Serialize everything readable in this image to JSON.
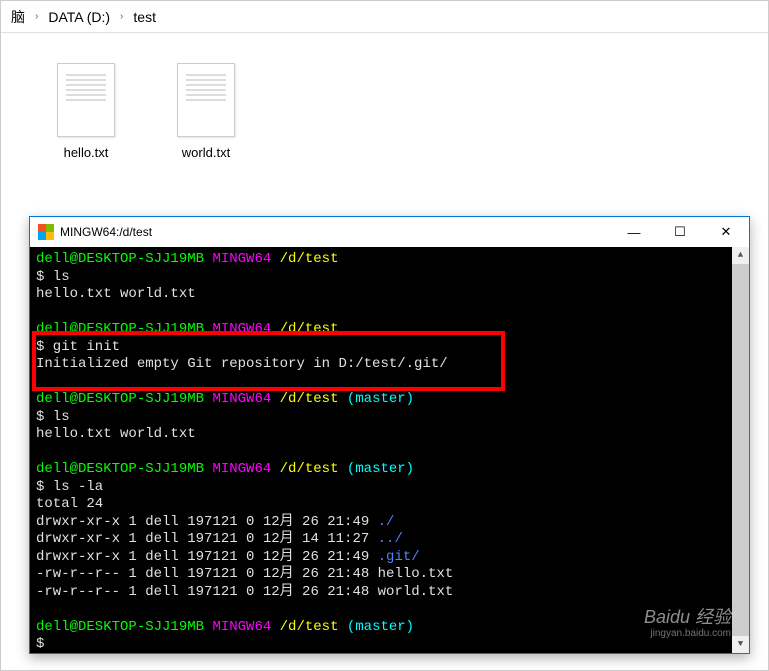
{
  "breadcrumb": {
    "seg0": "脑",
    "sep": "›",
    "seg1": "DATA (D:)",
    "seg2": "test"
  },
  "files": [
    {
      "name": "hello.txt"
    },
    {
      "name": "world.txt"
    }
  ],
  "window": {
    "title": "MINGW64:/d/test",
    "controls": {
      "min": "—",
      "max": "☐",
      "close": "✕"
    }
  },
  "terminal": {
    "block1": {
      "prompt": {
        "user": "dell@DESKTOP-SJJ19MB",
        "host": "MINGW64",
        "path": "/d/test"
      },
      "cmd": "$ ls",
      "out": "hello.txt  world.txt"
    },
    "block2": {
      "prompt": {
        "user": "dell@DESKTOP-SJJ19MB",
        "host": "MINGW64",
        "path": "/d/test"
      },
      "cmd": "$ git init",
      "out": "Initialized empty Git repository in D:/test/.git/"
    },
    "block3": {
      "prompt": {
        "user": "dell@DESKTOP-SJJ19MB",
        "host": "MINGW64",
        "path": "/d/test",
        "branch": "(master)"
      },
      "cmd": "$ ls",
      "out": "hello.txt  world.txt"
    },
    "block4": {
      "prompt": {
        "user": "dell@DESKTOP-SJJ19MB",
        "host": "MINGW64",
        "path": "/d/test",
        "branch": "(master)"
      },
      "cmd": "$ ls -la",
      "l0": "total 24",
      "l1a": "drwxr-xr-x 1 dell 197121 0 12月  26 21:49 ",
      "l1b": "./",
      "l2a": "drwxr-xr-x 1 dell 197121 0 12月  14 11:27 ",
      "l2b": "../",
      "l3a": "drwxr-xr-x 1 dell 197121 0 12月  26 21:49 ",
      "l3b": ".git/",
      "l4": "-rw-r--r-- 1 dell 197121 0 12月  26 21:48 hello.txt",
      "l5": "-rw-r--r-- 1 dell 197121 0 12月  26 21:48 world.txt"
    },
    "block5": {
      "prompt": {
        "user": "dell@DESKTOP-SJJ19MB",
        "host": "MINGW64",
        "path": "/d/test",
        "branch": "(master)"
      },
      "cmd": "$"
    }
  },
  "watermark": {
    "main": "Baidu 经验",
    "sub": "jingyan.baidu.com"
  }
}
